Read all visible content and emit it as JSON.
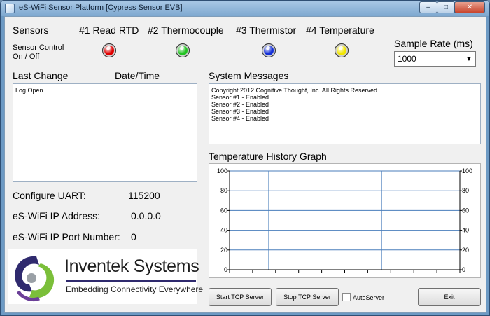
{
  "window": {
    "title": "eS-WiFi Sensor Platform [Cypress Sensor EVB]",
    "controls": {
      "minimize": "–",
      "maximize": "□",
      "close": "✕"
    }
  },
  "sensors": {
    "heading": "Sensors",
    "control_label_line1": "Sensor Control",
    "control_label_line2": "On / Off",
    "items": [
      {
        "label": "#1 Read RTD",
        "color": "#e00000"
      },
      {
        "label": "#2 Thermocouple",
        "color": "#22c322"
      },
      {
        "label": "#3 Thermistor",
        "color": "#1530d8"
      },
      {
        "label": "#4 Temperature",
        "color": "#f2e600"
      }
    ]
  },
  "sample_rate": {
    "label": "Sample Rate (ms)",
    "value": "1000"
  },
  "last_change": {
    "header": "Last Change",
    "date_header": "Date/Time",
    "log": "Log Open"
  },
  "system_messages": {
    "header": "System Messages",
    "lines": [
      "Copyright 2012 Cognitive Thought, Inc. All Rights Reserved.",
      "Sensor #1 - Enabled",
      "Sensor #2 - Enabled",
      "Sensor #3 - Enabled",
      "Sensor #4 - Enabled"
    ]
  },
  "config": {
    "uart_label": "Configure UART:",
    "uart_value": "115200",
    "ip_label": "eS-WiFi IP Address:",
    "ip_value": "0.0.0.0",
    "port_label": "eS-WiFi IP Port Number:",
    "port_value": "0"
  },
  "logo": {
    "company": "Inventek Systems",
    "tagline": "Embedding Connectivity Everywhere"
  },
  "graph": {
    "title": "Temperature History Graph",
    "y_ticks": [
      "0",
      "20",
      "40",
      "60",
      "80",
      "100"
    ],
    "ylim": [
      0,
      100
    ],
    "line_color": "#4a7ebb"
  },
  "buttons": {
    "start_tcp": "Start TCP Server",
    "stop_tcp": "Stop TCP Server",
    "autoserver": "AutoServer",
    "exit": "Exit"
  }
}
